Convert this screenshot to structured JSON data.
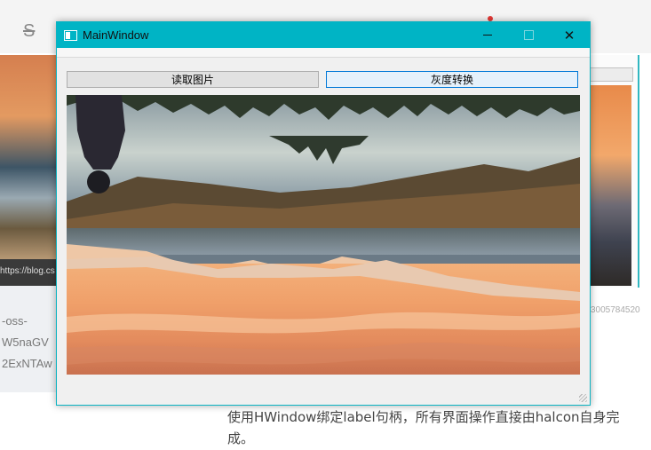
{
  "window": {
    "title": "MainWindow",
    "controls": {
      "minimize": "minimize",
      "maximize": "maximize",
      "close": "close"
    }
  },
  "toolbar": {
    "read_image_label": "读取图片",
    "grayscale_label": "灰度转换"
  },
  "background": {
    "left_link": "https://blog.cs",
    "left_lines": [
      "-oss-",
      "W5naGV",
      "2ExNTAw"
    ],
    "right_caption": "3005784520",
    "article_text": "使用HWindow绑定label句柄，所有界面操作直接由halcon自身完成。"
  },
  "colors": {
    "titlebar": "#00b4c5",
    "window_border": "#0ab3c2",
    "button_focus_border": "#0078d7"
  }
}
